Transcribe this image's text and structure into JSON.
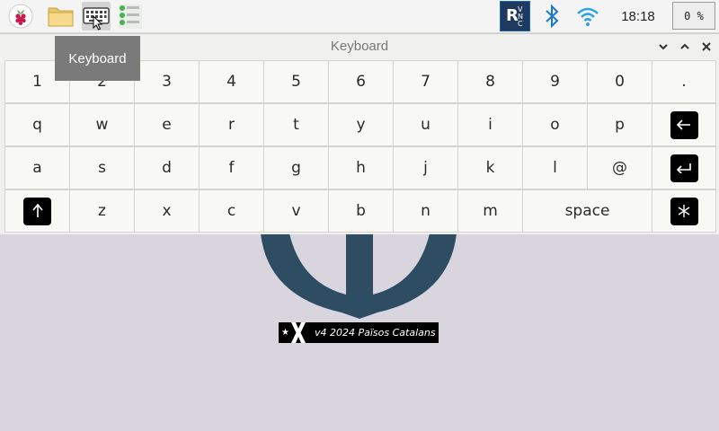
{
  "taskbar": {
    "icons": [
      "raspberry-menu-icon",
      "file-manager-icon",
      "keyboard-icon",
      "task-list-icon",
      "vnc-icon",
      "bluetooth-icon",
      "wifi-icon"
    ],
    "clock": "18:18",
    "cpu": "0 %"
  },
  "tooltip": {
    "text": "Keyboard"
  },
  "window": {
    "title": "Keyboard"
  },
  "keyboard": {
    "rows": [
      [
        "1",
        "2",
        "3",
        "4",
        "5",
        "6",
        "7",
        "8",
        "9",
        "0",
        "."
      ],
      [
        "q",
        "w",
        "e",
        "r",
        "t",
        "y",
        "u",
        "i",
        "o",
        "p"
      ],
      [
        "a",
        "s",
        "d",
        "f",
        "g",
        "h",
        "j",
        "k",
        "l",
        "@"
      ],
      [
        "z",
        "x",
        "c",
        "v",
        "b",
        "n",
        "m",
        "space"
      ]
    ],
    "special_keys": [
      "backspace-icon",
      "enter-icon",
      "shift-icon",
      "symbols-icon"
    ]
  },
  "wallpaper": {
    "banner_text": "v4  2024 Països Catalans"
  },
  "colors": {
    "desktop": "#d9d5df",
    "anchor": "#2e4d62",
    "vnc": "#1565c0",
    "bluetooth": "#1976d2"
  }
}
